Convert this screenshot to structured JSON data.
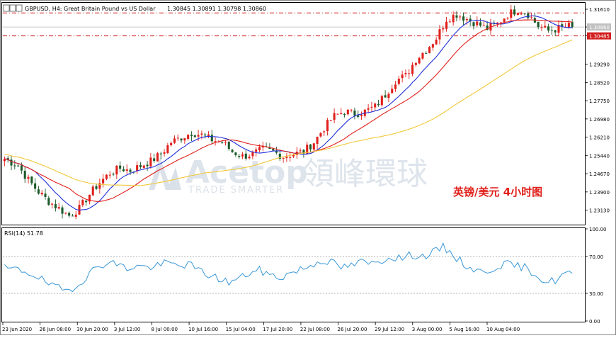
{
  "header": {
    "symbol": "GBPUSD, H4:",
    "description": "Great Britain Pound vs US Dollar",
    "ohlc": "1.30845 1.30891 1.30798 1.30860"
  },
  "watermark": {
    "brand_latin": "Acetop",
    "brand_cjk": "領峰環球",
    "tagline": "TRADE SMARTER"
  },
  "annotation": {
    "text": "英镑/美元 4小时图",
    "color": "#e0201b"
  },
  "colors": {
    "bull_candle": "#e0201b",
    "bear_candle": "#1c5a2a",
    "ma_fast": "#1f2fd9",
    "ma_mid": "#e0201b",
    "ma_slow": "#f0c83a",
    "rsi_line": "#3a98d8",
    "level_line": "#d21f1f"
  },
  "chart_data": [
    {
      "type": "candlestick",
      "title": "GBPUSD, H4",
      "y_ticks": [
        "1.31610",
        "1.30860",
        "1.30485",
        "1.29290",
        "1.28520",
        "1.27750",
        "1.26980",
        "1.26210",
        "1.25440",
        "1.24670",
        "1.23900",
        "1.23130"
      ],
      "ylim": [
        1.2255,
        1.3185
      ],
      "x_ticks": [
        "23 Jun 2020",
        "26 Jun 08:00",
        "30 Jun 20:00",
        "3 Jul 12:00",
        "8 Jul 00:00",
        "10 Jul 16:00",
        "15 Jul 04:00",
        "17 Jul 20:00",
        "22 Jul 08:00",
        "26 Jul 20:00",
        "29 Jul 12:00",
        "3 Aug 00:00",
        "5 Aug 16:00",
        "10 Aug 04:00"
      ],
      "current_price": 1.3086,
      "horizontal_levels": [
        {
          "value": 1.31453,
          "label": "1.31453"
        },
        {
          "value": 1.30485,
          "label": "1.30485"
        }
      ],
      "close_path": [
        [
          0,
          1.253
        ],
        [
          4,
          1.25
        ],
        [
          7,
          1.244
        ],
        [
          10,
          1.239
        ],
        [
          13,
          1.235
        ],
        [
          16,
          1.232
        ],
        [
          19,
          1.229
        ],
        [
          22,
          1.232
        ],
        [
          25,
          1.238
        ],
        [
          28,
          1.243
        ],
        [
          31,
          1.247
        ],
        [
          34,
          1.249
        ],
        [
          37,
          1.248
        ],
        [
          40,
          1.25
        ],
        [
          43,
          1.252
        ],
        [
          46,
          1.255
        ],
        [
          49,
          1.26
        ],
        [
          52,
          1.262
        ],
        [
          55,
          1.264
        ],
        [
          58,
          1.263
        ],
        [
          61,
          1.261
        ],
        [
          64,
          1.26
        ],
        [
          67,
          1.256
        ],
        [
          70,
          1.254
        ],
        [
          73,
          1.255
        ],
        [
          76,
          1.257
        ],
        [
          79,
          1.256
        ],
        [
          82,
          1.254
        ],
        [
          85,
          1.255
        ],
        [
          88,
          1.256
        ],
        [
          91,
          1.26
        ],
        [
          94,
          1.266
        ],
        [
          97,
          1.271
        ],
        [
          100,
          1.273
        ],
        [
          103,
          1.272
        ],
        [
          106,
          1.273
        ],
        [
          109,
          1.275
        ],
        [
          112,
          1.28
        ],
        [
          115,
          1.286
        ],
        [
          118,
          1.288
        ],
        [
          121,
          1.295
        ],
        [
          124,
          1.299
        ],
        [
          127,
          1.304
        ],
        [
          130,
          1.312
        ],
        [
          133,
          1.314
        ],
        [
          136,
          1.312
        ],
        [
          139,
          1.31
        ],
        [
          142,
          1.308
        ],
        [
          145,
          1.31
        ],
        [
          148,
          1.314
        ],
        [
          151,
          1.316
        ],
        [
          154,
          1.314
        ],
        [
          157,
          1.309
        ],
        [
          160,
          1.307
        ],
        [
          163,
          1.308
        ],
        [
          166,
          1.309
        ],
        [
          168,
          1.3086
        ]
      ],
      "moving_averages": [
        {
          "color_key": "ma_fast",
          "period": 10
        },
        {
          "color_key": "ma_mid",
          "period": 20
        },
        {
          "color_key": "ma_slow",
          "period": 60
        }
      ],
      "bar_count": 168
    },
    {
      "type": "line",
      "title": "RSI(14) 51.78",
      "y_ticks": [
        "100.00",
        "70.00",
        "30.00",
        "0.00"
      ],
      "ylim": [
        0,
        100
      ],
      "levels": [
        70,
        30
      ],
      "rsi_path": [
        [
          0,
          57
        ],
        [
          5,
          55
        ],
        [
          9,
          50
        ],
        [
          12,
          42
        ],
        [
          15,
          36
        ],
        [
          18,
          33
        ],
        [
          21,
          38
        ],
        [
          24,
          48
        ],
        [
          27,
          58
        ],
        [
          30,
          64
        ],
        [
          33,
          62
        ],
        [
          36,
          57
        ],
        [
          39,
          60
        ],
        [
          42,
          58
        ],
        [
          45,
          60
        ],
        [
          48,
          63
        ],
        [
          51,
          60
        ],
        [
          54,
          62
        ],
        [
          57,
          55
        ],
        [
          60,
          50
        ],
        [
          63,
          46
        ],
        [
          66,
          42
        ],
        [
          69,
          46
        ],
        [
          72,
          52
        ],
        [
          75,
          55
        ],
        [
          78,
          50
        ],
        [
          81,
          47
        ],
        [
          84,
          52
        ],
        [
          87,
          56
        ],
        [
          90,
          60
        ],
        [
          93,
          66
        ],
        [
          96,
          64
        ],
        [
          99,
          58
        ],
        [
          102,
          60
        ],
        [
          105,
          64
        ],
        [
          108,
          62
        ],
        [
          111,
          66
        ],
        [
          114,
          70
        ],
        [
          117,
          68
        ],
        [
          120,
          72
        ],
        [
          123,
          70
        ],
        [
          126,
          74
        ],
        [
          129,
          80
        ],
        [
          132,
          72
        ],
        [
          135,
          62
        ],
        [
          138,
          56
        ],
        [
          141,
          52
        ],
        [
          144,
          58
        ],
        [
          147,
          62
        ],
        [
          150,
          60
        ],
        [
          153,
          58
        ],
        [
          156,
          52
        ],
        [
          159,
          42
        ],
        [
          162,
          44
        ],
        [
          165,
          52
        ],
        [
          168,
          52
        ]
      ],
      "last_value": 51.78
    }
  ]
}
